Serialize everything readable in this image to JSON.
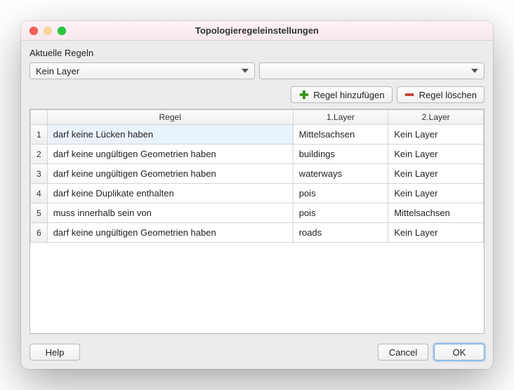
{
  "window": {
    "title": "Topologieregeleinstellungen"
  },
  "section_label": "Aktuelle Regeln",
  "combo_left": {
    "value": "Kein Layer"
  },
  "combo_right": {
    "value": ""
  },
  "buttons": {
    "add_rule": "Regel hinzufügen",
    "delete_rule": "Regel löschen",
    "help": "Help",
    "cancel": "Cancel",
    "ok": "OK"
  },
  "table": {
    "headers": {
      "rule": "Regel",
      "layer1": "1.Layer",
      "layer2": "2.Layer"
    },
    "rows": [
      {
        "rule": "darf keine Lücken haben",
        "layer1": "Mittelsachsen",
        "layer2": "Kein Layer",
        "selected": true
      },
      {
        "rule": "darf keine ungültigen Geometrien haben",
        "layer1": "buildings",
        "layer2": "Kein Layer"
      },
      {
        "rule": "darf keine ungültigen Geometrien haben",
        "layer1": "waterways",
        "layer2": "Kein Layer"
      },
      {
        "rule": "darf keine Duplikate enthalten",
        "layer1": "pois",
        "layer2": "Kein Layer"
      },
      {
        "rule": "muss innerhalb sein von",
        "layer1": "pois",
        "layer2": "Mittelsachsen"
      },
      {
        "rule": "darf keine ungültigen Geometrien haben",
        "layer1": "roads",
        "layer2": "Kein Layer"
      }
    ]
  }
}
